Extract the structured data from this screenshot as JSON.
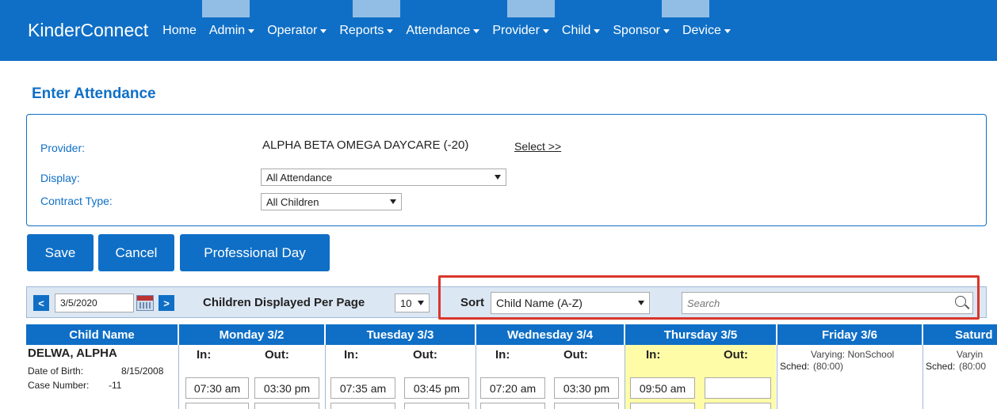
{
  "nav": {
    "brand": "KinderConnect",
    "items": [
      "Home",
      "Admin",
      "Operator",
      "Reports",
      "Attendance",
      "Provider",
      "Child",
      "Sponsor",
      "Device"
    ]
  },
  "page": {
    "title": "Enter Attendance"
  },
  "filters": {
    "provider_label": "Provider:",
    "provider_value": "ALPHA BETA OMEGA DAYCARE (-20)",
    "select_link": "Select >>",
    "display_label": "Display:",
    "display_value": "All Attendance",
    "contract_label": "Contract Type:",
    "contract_value": "All Children"
  },
  "actions": {
    "save": "Save",
    "cancel": "Cancel",
    "professional_day": "Professional Day"
  },
  "toolbar": {
    "prev": "<",
    "next": ">",
    "date": "3/5/2020",
    "per_page_label": "Children Displayed Per Page",
    "per_page_value": "10",
    "sort_label": "Sort",
    "sort_value": "Child Name (A-Z)",
    "search_placeholder": "Search"
  },
  "grid": {
    "headers": [
      "Child Name",
      "Monday 3/2",
      "Tuesday 3/3",
      "Wednesday 3/4",
      "Thursday 3/5",
      "Friday 3/6",
      "Saturd"
    ],
    "in_label": "In:",
    "out_label": "Out:",
    "child": {
      "name": "DELWA, ALPHA",
      "dob_label": "Date of Birth:",
      "dob": "8/15/2008",
      "case_label": "Case Number:",
      "case": "-11"
    },
    "times": {
      "mon_in": "07:30 am",
      "mon_out": "03:30 pm",
      "tue_in": "07:35 am",
      "tue_out": "03:45 pm",
      "wed_in": "07:20 am",
      "wed_out": "03:30 pm",
      "thu_in": "09:50 am",
      "thu_out": ""
    },
    "sched_label": "Sched:",
    "friday_sched": "Varying: NonSchool",
    "friday_hours": "(80:00)",
    "saturday_sched": "Varyin",
    "saturday_hours": "(80:00"
  },
  "colors": {
    "brand": "#0f6fc6",
    "highlight": "#d9362b",
    "today": "#fffca8"
  }
}
